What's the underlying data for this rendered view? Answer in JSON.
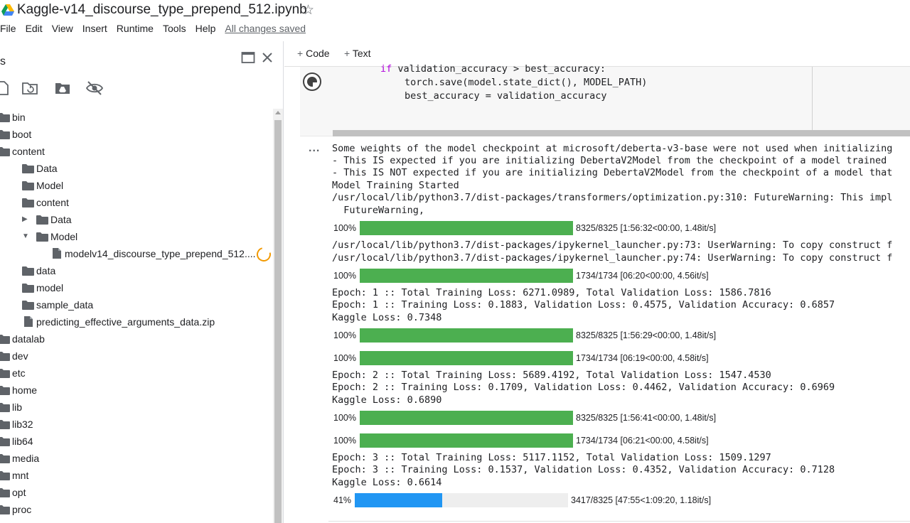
{
  "header": {
    "title": "Kaggle-v14_discourse_type_prepend_512.ipynb",
    "star_icon": "star-outline-icon",
    "menu": [
      "File",
      "Edit",
      "View",
      "Insert",
      "Runtime",
      "Tools",
      "Help"
    ],
    "save_status": "All changes saved"
  },
  "sidebar": {
    "title": "s",
    "tree": [
      {
        "label": "bin",
        "type": "folder",
        "depth": 0
      },
      {
        "label": "boot",
        "type": "folder",
        "depth": 0
      },
      {
        "label": "content",
        "type": "folder",
        "depth": 0
      },
      {
        "label": "Data",
        "type": "folder",
        "depth": 1
      },
      {
        "label": "Model",
        "type": "folder",
        "depth": 1
      },
      {
        "label": "content",
        "type": "folder",
        "depth": 1
      },
      {
        "label": "Data",
        "type": "folder",
        "depth": 2,
        "caret": "collapsed"
      },
      {
        "label": "Model",
        "type": "folder",
        "depth": 2,
        "caret": "expanded"
      },
      {
        "label": "modelv14_discourse_type_prepend_512....",
        "type": "file",
        "depth": 3
      },
      {
        "label": "data",
        "type": "folder",
        "depth": 1
      },
      {
        "label": "model",
        "type": "folder",
        "depth": 1
      },
      {
        "label": "sample_data",
        "type": "folder",
        "depth": 1
      },
      {
        "label": "predicting_effective_arguments_data.zip",
        "type": "file",
        "depth": 1
      },
      {
        "label": "datalab",
        "type": "folder",
        "depth": 0
      },
      {
        "label": "dev",
        "type": "folder",
        "depth": 0
      },
      {
        "label": "etc",
        "type": "folder",
        "depth": 0
      },
      {
        "label": "home",
        "type": "folder",
        "depth": 0
      },
      {
        "label": "lib",
        "type": "folder",
        "depth": 0
      },
      {
        "label": "lib32",
        "type": "folder",
        "depth": 0
      },
      {
        "label": "lib64",
        "type": "folder",
        "depth": 0
      },
      {
        "label": "media",
        "type": "folder",
        "depth": 0
      },
      {
        "label": "mnt",
        "type": "folder",
        "depth": 0
      },
      {
        "label": "opt",
        "type": "folder",
        "depth": 0
      },
      {
        "label": "proc",
        "type": "folder",
        "depth": 0
      }
    ]
  },
  "notebook": {
    "toolbar": {
      "code_label": "Code",
      "text_label": "Text"
    },
    "code": {
      "line1_kw": "if",
      "line1_rest": " validation_accuracy > best_accuracy:",
      "line2": "torch.save(model.state_dict(), MODEL_PATH)",
      "line3": "best_accuracy = validation_accuracy"
    },
    "output_menu_label": "...",
    "output": {
      "warn1": "Some weights of the model checkpoint at microsoft/deberta-v3-base were not used when initializing",
      "warn2": "- This IS expected if you are initializing DebertaV2Model from the checkpoint of a model trained",
      "warn3": "- This IS NOT expected if you are initializing DebertaV2Model from the checkpoint of a model that",
      "started": "Model Training Started",
      "future1": "/usr/local/lib/python3.7/dist-packages/transformers/optimization.py:310: FutureWarning: This impl",
      "future2": "  FutureWarning,",
      "user1": "/usr/local/lib/python3.7/dist-packages/ipykernel_launcher.py:73: UserWarning: To copy construct f",
      "user2": "/usr/local/lib/python3.7/dist-packages/ipykernel_launcher.py:74: UserWarning: To copy construct f",
      "e1a": "Epoch: 1 :: Total Training Loss: 6271.0989, Total Validation Loss: 1586.7816",
      "e1b": "Epoch: 1 :: Training Loss: 0.1883, Validation Loss: 0.4575, Validation Accuracy: 0.6857",
      "e1c": "Kaggle Loss: 0.7348",
      "e2a": "Epoch: 2 :: Total Training Loss: 5689.4192, Total Validation Loss: 1547.4530",
      "e2b": "Epoch: 2 :: Training Loss: 0.1709, Validation Loss: 0.4462, Validation Accuracy: 0.6969",
      "e2c": "Kaggle Loss: 0.6890",
      "e3a": "Epoch: 3 :: Total Training Loss: 5117.1152, Total Validation Loss: 1509.1297",
      "e3b": "Epoch: 3 :: Training Loss: 0.1537, Validation Loss: 0.4352, Validation Accuracy: 0.7128",
      "e3c": "Kaggle Loss: 0.6614"
    },
    "progress": [
      {
        "pct": "100%",
        "fraction": 1.0,
        "stat": "8325/8325 [1:56:32<00:00, 1.48it/s]",
        "color": "#4caf50"
      },
      {
        "pct": "100%",
        "fraction": 1.0,
        "stat": "1734/1734 [06:20<00:00, 4.56it/s]",
        "color": "#4caf50"
      },
      {
        "pct": "100%",
        "fraction": 1.0,
        "stat": "8325/8325 [1:56:29<00:00, 1.48it/s]",
        "color": "#4caf50"
      },
      {
        "pct": "100%",
        "fraction": 1.0,
        "stat": "1734/1734 [06:19<00:00, 4.58it/s]",
        "color": "#4caf50"
      },
      {
        "pct": "100%",
        "fraction": 1.0,
        "stat": "8325/8325 [1:56:41<00:00, 1.48it/s]",
        "color": "#4caf50"
      },
      {
        "pct": "100%",
        "fraction": 1.0,
        "stat": "1734/1734 [06:21<00:00, 4.58it/s]",
        "color": "#4caf50"
      },
      {
        "pct": "41%",
        "fraction": 0.41,
        "stat": "3417/8325 [47:55<1:09:20, 1.18it/s]",
        "color": "#2196f3"
      }
    ]
  }
}
